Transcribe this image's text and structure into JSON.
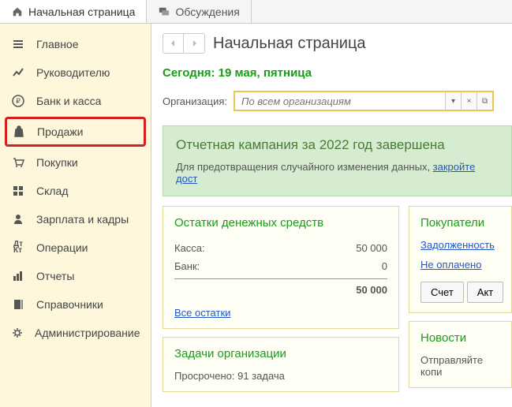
{
  "tabs": [
    {
      "label": "Начальная страница",
      "icon": "home"
    },
    {
      "label": "Обсуждения",
      "icon": "chat"
    }
  ],
  "sidebar": {
    "items": [
      {
        "label": "Главное",
        "icon": "menu"
      },
      {
        "label": "Руководителю",
        "icon": "trend"
      },
      {
        "label": "Банк и касса",
        "icon": "ruble"
      },
      {
        "label": "Продажи",
        "icon": "bag",
        "highlighted": true
      },
      {
        "label": "Покупки",
        "icon": "cart"
      },
      {
        "label": "Склад",
        "icon": "grid"
      },
      {
        "label": "Зарплата и кадры",
        "icon": "person"
      },
      {
        "label": "Операции",
        "icon": "ops"
      },
      {
        "label": "Отчеты",
        "icon": "stats"
      },
      {
        "label": "Справочники",
        "icon": "book"
      },
      {
        "label": "Администрирование",
        "icon": "gear"
      }
    ]
  },
  "page": {
    "title": "Начальная страница",
    "date": "Сегодня: 19 мая, пятница",
    "org_label": "Организация:",
    "org_placeholder": "По всем организациям"
  },
  "banner": {
    "title": "Отчетная кампания за 2022 год завершена",
    "text": "Для предотвращения случайного изменения данных, ",
    "link": "закройте дост"
  },
  "balances": {
    "title": "Остатки денежных средств",
    "rows": [
      {
        "label": "Касса:",
        "value": "50 000"
      },
      {
        "label": "Банк:",
        "value": "0"
      }
    ],
    "total": "50 000",
    "all_link": "Все остатки"
  },
  "buyers": {
    "title": "Покупатели",
    "links": [
      "Задолженность",
      "Не оплачено"
    ],
    "buttons": [
      "Счет",
      "Акт"
    ]
  },
  "tasks": {
    "title": "Задачи организации",
    "subtitle": "Просрочено: 91 задача"
  },
  "news": {
    "title": "Новости",
    "subtitle": "Отправляйте копи"
  }
}
